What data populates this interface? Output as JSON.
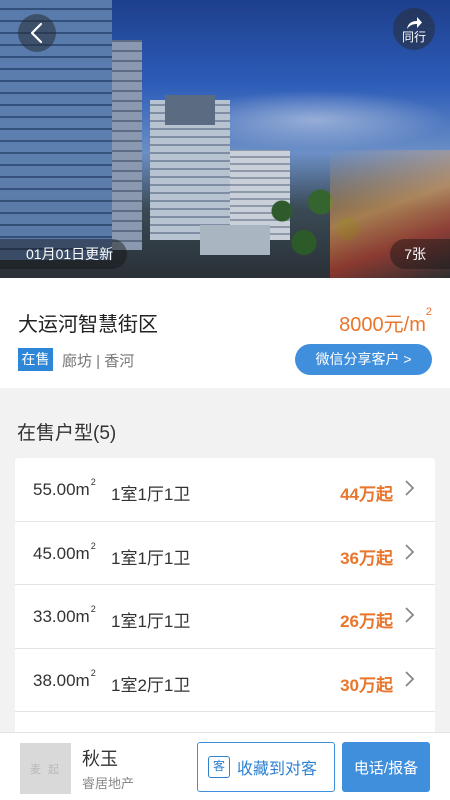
{
  "hero": {
    "update_text": "01月01日更新",
    "photo_count": "7张",
    "share_label": "同行"
  },
  "property": {
    "title": "大运河智慧街区",
    "price_value": "8000元/m",
    "price_unit_sup": "2",
    "status_tag": "在售",
    "location": "廊坊 | 香河",
    "wechat_share_label": "微信分享客户 >"
  },
  "units_section": {
    "title": "在售户型(5)",
    "rows": [
      {
        "area": "55.00m",
        "area_sup": "2",
        "layout": "1室1厅1卫",
        "price": "44万起"
      },
      {
        "area": "45.00m",
        "area_sup": "2",
        "layout": "1室1厅1卫",
        "price": "36万起"
      },
      {
        "area": "33.00m",
        "area_sup": "2",
        "layout": "1室1厅1卫",
        "price": "26万起"
      },
      {
        "area": "38.00m",
        "area_sup": "2",
        "layout": "1室2厅1卫",
        "price": "30万起"
      },
      {
        "area": "",
        "area_sup": "",
        "layout": "",
        "price": ""
      }
    ]
  },
  "bottom_bar": {
    "avatar_text": "麦 起",
    "agent_name": "秋玉",
    "agent_company": "睿居地产",
    "favorite_icon_text": "客",
    "favorite_label": "收藏到对客",
    "call_label": "电话/报备"
  },
  "colors": {
    "accent_blue": "#3f8fdc",
    "price_orange": "#e8762c"
  }
}
